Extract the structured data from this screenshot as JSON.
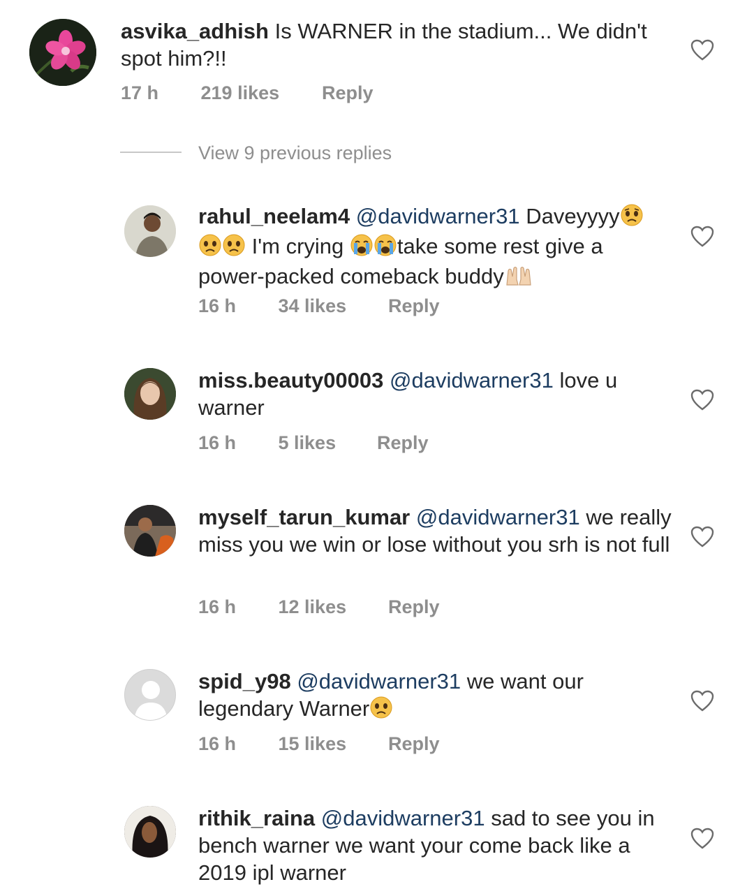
{
  "comments": [
    {
      "username": "asvika_adhish",
      "mention": "",
      "text": "Is WARNER in the stadium... We didn't spot him?!!",
      "time": "17 h",
      "likes": "219 likes",
      "reply": "Reply",
      "avatar": "flower-avatar"
    },
    {
      "username": "rahul_neelam4",
      "mention": "@davidwarner31",
      "text": "Daveyyyy",
      "text2": "I'm crying",
      "text3": "take some rest give a power-packed comeback buddy",
      "time": "16 h",
      "likes": "34 likes",
      "reply": "Reply",
      "avatar": "person-avatar"
    },
    {
      "username": "miss.beauty00003",
      "mention": "@davidwarner31",
      "text": "love u warner",
      "time": "16 h",
      "likes": "5 likes",
      "reply": "Reply",
      "avatar": "person-avatar"
    },
    {
      "username": "myself_tarun_kumar",
      "mention": "@davidwarner31",
      "text": "we really miss you we win or lose without you srh is not full",
      "time": "16 h",
      "likes": "12 likes",
      "reply": "Reply",
      "avatar": "person-avatar"
    },
    {
      "username": "spid_y98",
      "mention": "@davidwarner31",
      "text": " we want our legendary Warner",
      "time": "16 h",
      "likes": "15 likes",
      "reply": "Reply",
      "avatar": "default-avatar"
    },
    {
      "username": "rithik_raina",
      "mention": "@davidwarner31",
      "text": "sad to see you in bench warner we want your come back like a 2019 ipl warner",
      "time": "",
      "likes": "",
      "reply": "",
      "avatar": "person-avatar"
    }
  ],
  "view_replies": "View 9 previous replies",
  "colors": {
    "text": "#262626",
    "meta": "#8e8e8e",
    "mention": "#1d3d61"
  }
}
